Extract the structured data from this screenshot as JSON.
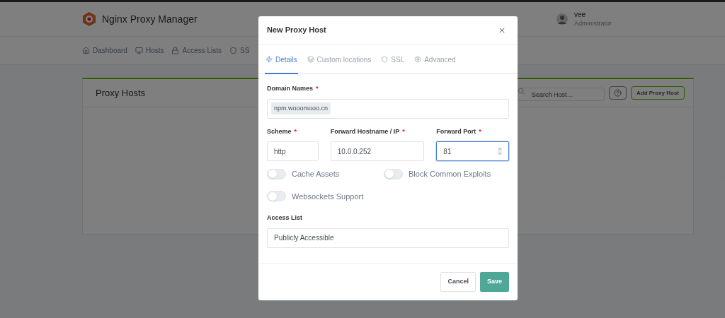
{
  "app": {
    "brand": "Nginx Proxy Manager",
    "user": {
      "name": "vee",
      "role": "Administrator"
    },
    "nav": [
      {
        "label": "Dashboard"
      },
      {
        "label": "Hosts"
      },
      {
        "label": "Access Lists"
      },
      {
        "label": "SS"
      }
    ],
    "card": {
      "title": "Proxy Hosts",
      "search": {
        "placeholder": "Search Host…"
      },
      "add_button": "Add Proxy Host"
    }
  },
  "modal": {
    "title": "New Proxy Host",
    "tabs": [
      {
        "label": "Details",
        "selected": true
      },
      {
        "label": "Custom locations",
        "selected": false
      },
      {
        "label": "SSL",
        "selected": false
      },
      {
        "label": "Advanced",
        "selected": false
      }
    ],
    "domain": {
      "label": "Domain Names",
      "required_mark": "*",
      "tags": [
        "npm.wooomooo.cn"
      ]
    },
    "fields": [
      {
        "label": "Scheme",
        "required_mark": "*",
        "value": "http",
        "focused": false,
        "kind": "text"
      },
      {
        "label": "Forward Hostname / IP",
        "required_mark": "*",
        "value": "10.0.0.252",
        "focused": false,
        "kind": "text"
      },
      {
        "label": "Forward Port",
        "required_mark": "*",
        "value": "81",
        "focused": true,
        "kind": "number"
      }
    ],
    "toggles": [
      {
        "label": "Cache Assets",
        "on": false
      },
      {
        "label": "Block Common Exploits",
        "on": false
      },
      {
        "label": "Websockets Support",
        "on": false
      }
    ],
    "access_list": {
      "label": "Access List",
      "value": "Publicly Accessible"
    },
    "buttons": {
      "cancel": "Cancel",
      "save": "Save"
    }
  }
}
